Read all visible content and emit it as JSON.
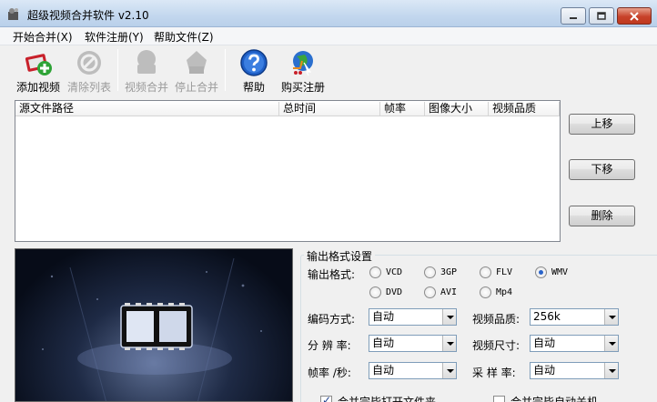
{
  "window": {
    "title": "超级视频合并软件 v2.10"
  },
  "menu": [
    "开始合并(X)",
    "软件注册(Y)",
    "帮助文件(Z)"
  ],
  "toolbar": {
    "add_video": "添加视频",
    "clear_list": "清除列表",
    "merge_video": "视频合并",
    "stop_merge": "停止合并",
    "help": "帮助",
    "buy_register": "购买注册"
  },
  "file_list": {
    "columns": [
      "源文件路径",
      "总时间",
      "帧率",
      "图像大小",
      "视频品质"
    ]
  },
  "side_buttons": {
    "move_up": "上移",
    "move_down": "下移",
    "delete": "删除"
  },
  "output": {
    "group_title": "输出格式设置",
    "format_label": "输出格式:",
    "formats": [
      "VCD",
      "3GP",
      "FLV",
      "WMV",
      "DVD",
      "AVI",
      "Mp4"
    ],
    "selected_format": "WMV",
    "encoding_label": "编码方式:",
    "encoding_value": "自动",
    "quality_label": "视频品质:",
    "quality_value": "256k",
    "resolution_label": "分 辨 率:",
    "resolution_value": "自动",
    "size_label": "视频尺寸:",
    "size_value": "自动",
    "framerate_label": "帧率 /秒:",
    "framerate_value": "自动",
    "samplerate_label": "采 样 率:",
    "samplerate_value": "自动",
    "open_folder_label": "合并完毕打开文件夹",
    "open_folder_checked": true,
    "shutdown_label": "合并完毕自动关机",
    "shutdown_checked": false
  },
  "colors": {
    "accent": "#2a63c9",
    "close_button": "#c7422a"
  }
}
